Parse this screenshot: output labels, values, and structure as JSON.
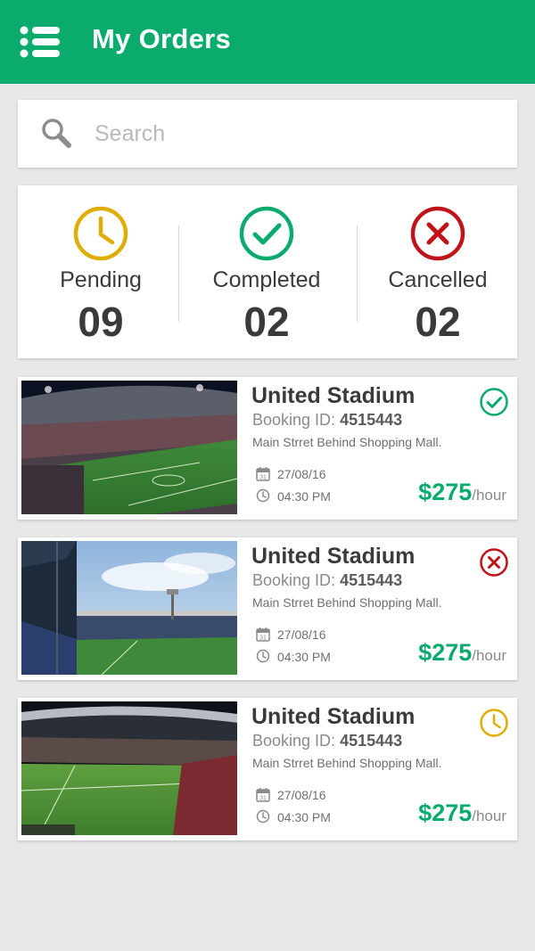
{
  "header": {
    "title": "My Orders",
    "menu_icon": "hamburger-menu-icon",
    "color": "#0aab6c"
  },
  "search": {
    "placeholder": "Search",
    "icon": "search-icon"
  },
  "stats": [
    {
      "label": "Pending",
      "count": "09",
      "icon": "clock-icon",
      "color": "#e0ac06"
    },
    {
      "label": "Completed",
      "count": "02",
      "icon": "check-circle-icon",
      "color": "#0aab6c"
    },
    {
      "label": "Cancelled",
      "count": "02",
      "icon": "x-circle-icon",
      "color": "#c0141b"
    }
  ],
  "orders": [
    {
      "title": "United Stadium",
      "booking_label": "Booking ID:",
      "booking_id": "4515443",
      "address": "Main Strret Behind Shopping Mall.",
      "date": "27/08/16",
      "time": "04:30 PM",
      "price": "$275",
      "unit": "/hour",
      "status": "completed",
      "status_icon": "check-circle-icon"
    },
    {
      "title": "United Stadium",
      "booking_label": "Booking ID:",
      "booking_id": "4515443",
      "address": "Main Strret Behind Shopping Mall.",
      "date": "27/08/16",
      "time": "04:30 PM",
      "price": "$275",
      "unit": "/hour",
      "status": "cancelled",
      "status_icon": "x-circle-icon"
    },
    {
      "title": "United Stadium",
      "booking_label": "Booking ID:",
      "booking_id": "4515443",
      "address": "Main Strret Behind Shopping Mall.",
      "date": "27/08/16",
      "time": "04:30 PM",
      "price": "$275",
      "unit": "/hour",
      "status": "pending",
      "status_icon": "clock-icon"
    }
  ]
}
